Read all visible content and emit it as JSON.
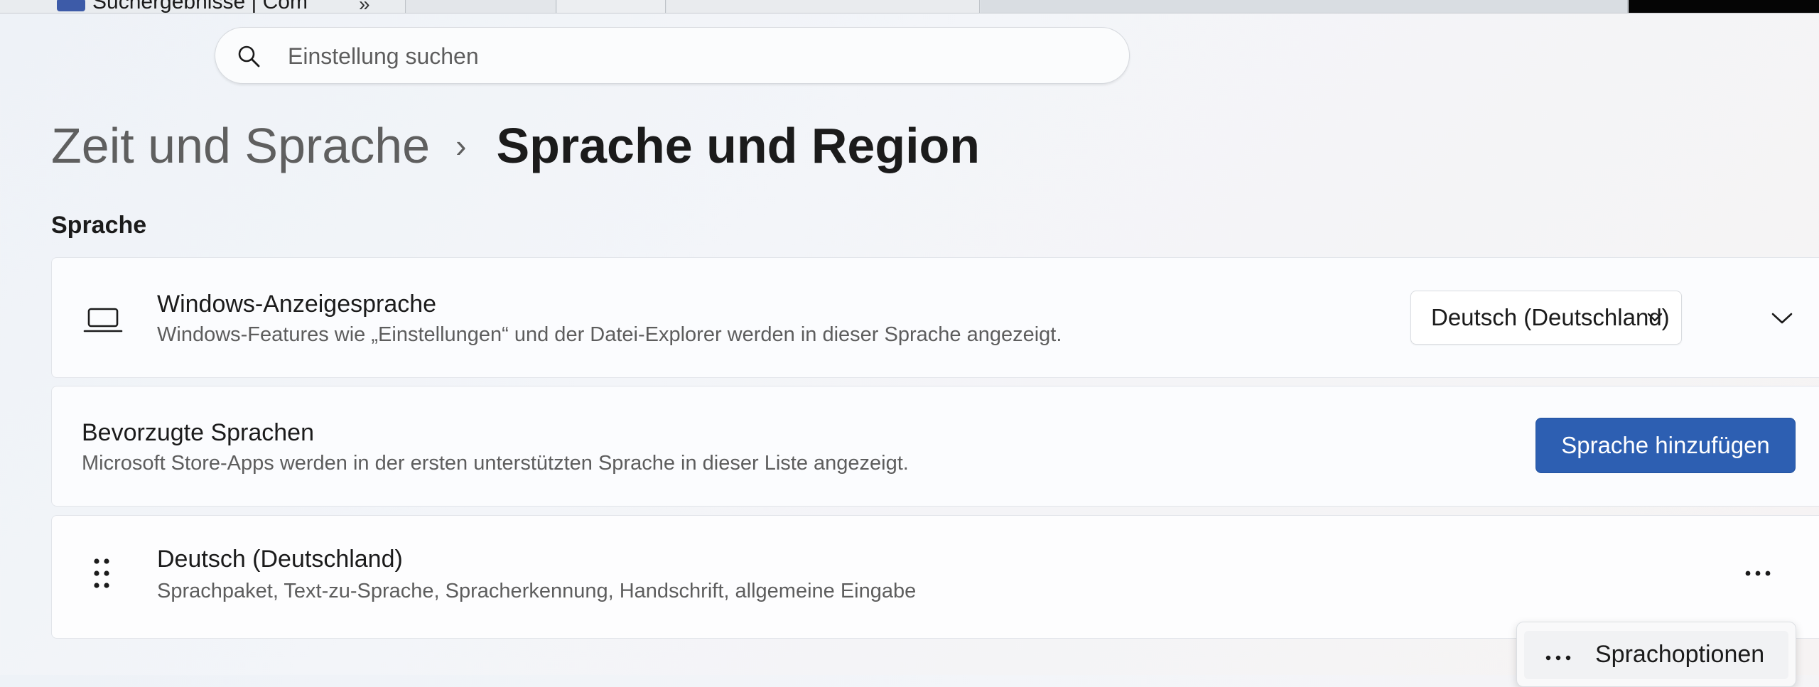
{
  "browser_strip": {
    "tab_title": "Suchergebnisse | Com",
    "overflow_glyph": "»"
  },
  "search": {
    "placeholder": "Einstellung suchen",
    "icon": "search-icon"
  },
  "breadcrumb": {
    "parent": "Zeit und Sprache",
    "separator": "›",
    "current": "Sprache und Region"
  },
  "section": {
    "title": "Sprache"
  },
  "display_language": {
    "icon": "laptop-icon",
    "title": "Windows-Anzeigesprache",
    "description": "Windows-Features wie „Einstellungen“ und der Datei-Explorer werden in dieser Sprache angezeigt.",
    "selected_value": "Deutsch (Deutschland)"
  },
  "preferred_languages": {
    "title": "Bevorzugte Sprachen",
    "description": "Microsoft Store-Apps werden in der ersten unterstützten Sprache in dieser Liste angezeigt.",
    "add_button_label": "Sprache hinzufügen"
  },
  "language_item": {
    "icon": "drag-handle-icon",
    "title": "Deutsch (Deutschland)",
    "description": "Sprachpaket, Text-zu-Sprache, Spracherkennung, Handschrift, allgemeine Eingabe",
    "more_icon": "more-icon"
  },
  "context_menu": {
    "items": [
      {
        "icon": "more-icon",
        "label": "Sprachoptionen"
      }
    ]
  },
  "colors": {
    "accent": "#2d5fb2",
    "background": "#eef2f7",
    "card": "#fbfcfe"
  }
}
